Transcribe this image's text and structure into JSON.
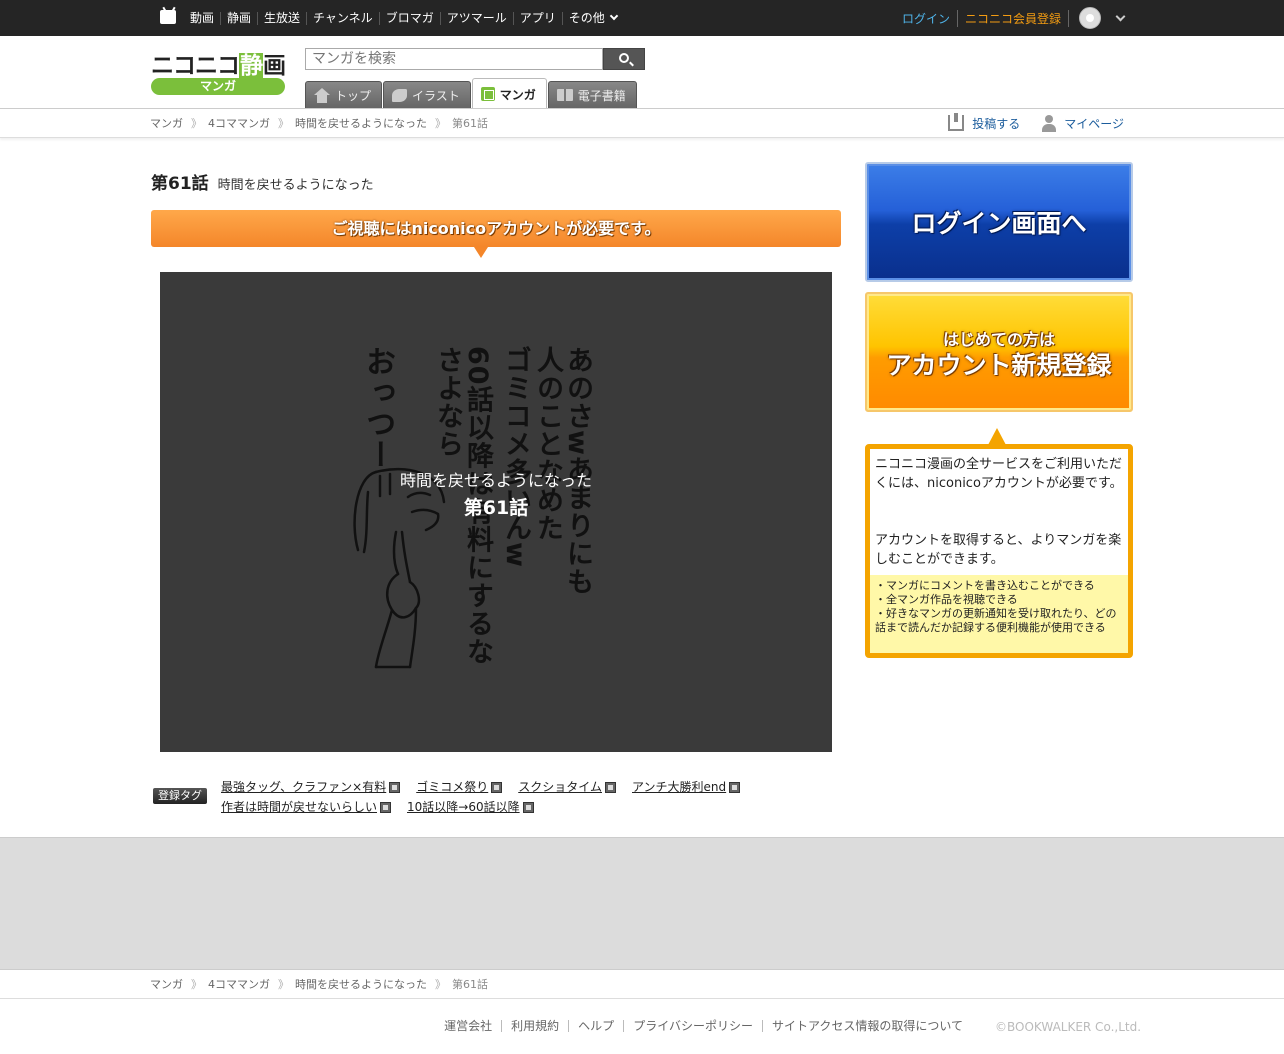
{
  "topnav": {
    "items": [
      "動画",
      "静画",
      "生放送",
      "チャンネル",
      "ブロマガ",
      "アツマール",
      "アプリ",
      "その他"
    ],
    "login": "ログイン",
    "register": "ニコニコ会員登録"
  },
  "header": {
    "logo_text_a": "ニコニコ",
    "logo_text_b": "静",
    "logo_text_c": "画",
    "logo_sub": "マンガ",
    "search_placeholder": "マンガを検索",
    "tabs": [
      {
        "label": "トップ"
      },
      {
        "label": "イラスト"
      },
      {
        "label": "マンガ"
      },
      {
        "label": "電子書籍"
      }
    ]
  },
  "breadcrumb": [
    "マンガ",
    "4コママンガ",
    "時間を戻せるようになった",
    "第61話"
  ],
  "utils": {
    "post": "投稿する",
    "mypage": "マイページ"
  },
  "episode": {
    "number": "第61話",
    "series": "時間を戻せるようになった"
  },
  "notice": "ご視聴にはniconicoアカウントが必要です。",
  "viewer": {
    "lines": [
      "あのさwあまりにも",
      "人のことなめた",
      "ゴミコメ多いんw",
      "60話以降は有料にするな",
      "さよなら",
      "おっつー"
    ],
    "overlay_sub": "時間を戻せるようになった",
    "overlay_title": "第61話"
  },
  "tags": {
    "label": "登録タグ",
    "items": [
      "最強タッグ、クラファン×有料",
      "ゴミコメ祭り",
      "スクショタイム",
      "アンチ大勝利end",
      "作者は時間が戻せないらしい",
      "10話以降→60話以降"
    ]
  },
  "sidebar": {
    "login_button": "ログイン画面へ",
    "register_line1": "はじめての方は",
    "register_line2": "アカウント新規登録",
    "info_p1": "ニコニコ漫画の全サービスをご利用いただくには、niconicoアカウントが必要です。",
    "info_p2": "アカウントを取得すると、よりマンガを楽しむことができます。",
    "perks": [
      "・マンガにコメントを書き込むことができる",
      "・全マンガ作品を視聴できる",
      "・好きなマンガの更新通知を受け取れたり、どの話まで読んだか記録する便利機能が使用できる"
    ]
  },
  "footer": {
    "links": [
      "運営会社",
      "利用規約",
      "ヘルプ",
      "プライバシーポリシー",
      "サイトアクセス情報の取得について"
    ],
    "copyright": "©BOOKWALKER Co.,Ltd."
  },
  "colors": {
    "topbar": "#252525",
    "accent_green": "#7bbf3b",
    "notice_orange": "#f4862a",
    "login_blue": "#0d3fa8",
    "register_orange": "#ff9c00",
    "info_border": "#f4a400"
  }
}
